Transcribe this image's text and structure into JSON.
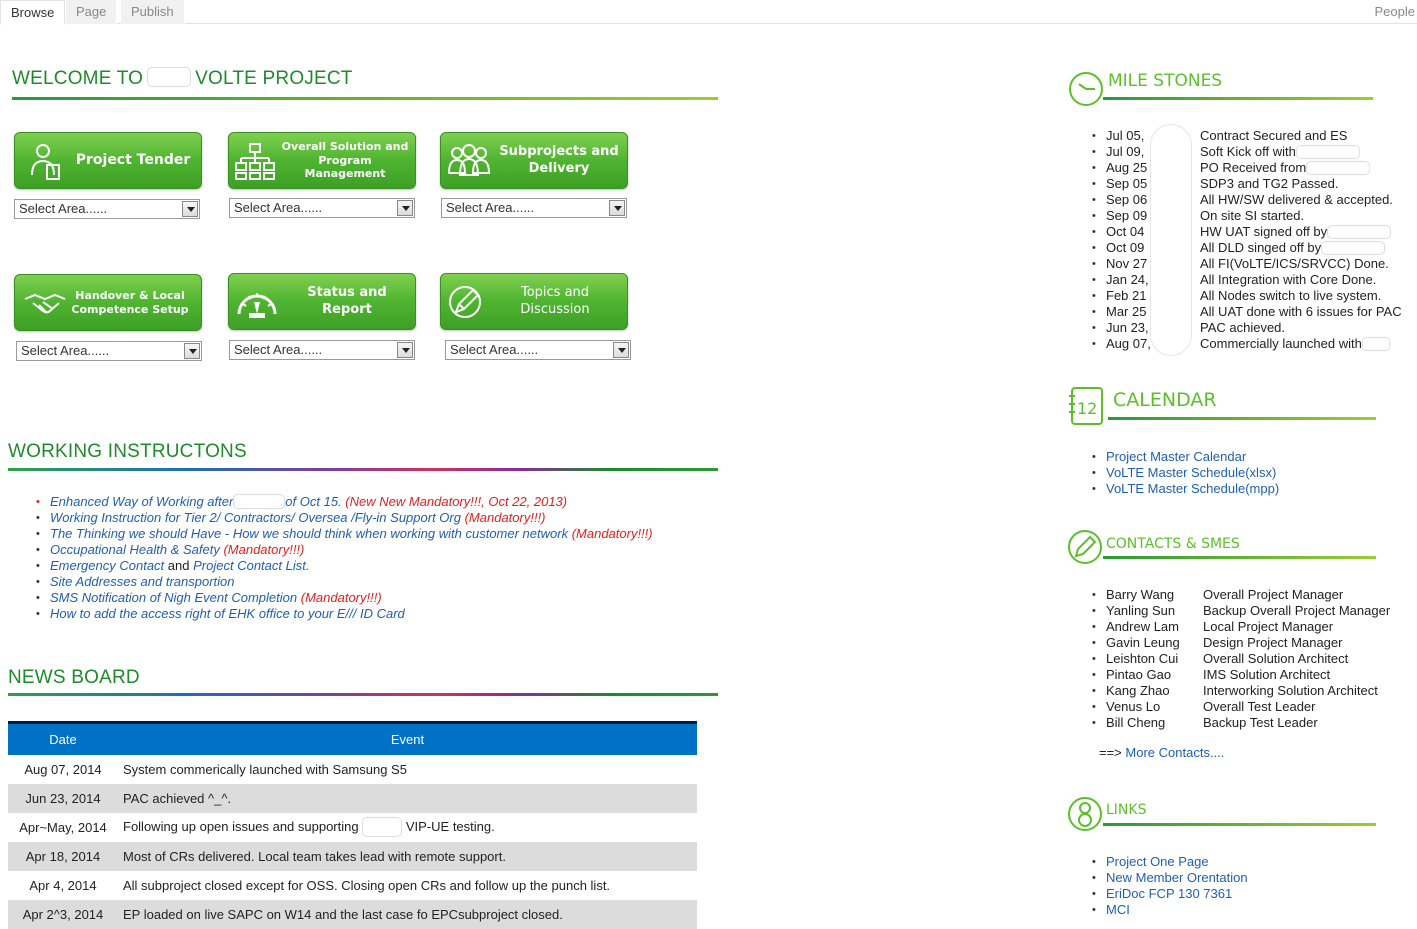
{
  "ribbon": {
    "tabs": [
      "Browse",
      "Page",
      "Publish"
    ],
    "people": "People"
  },
  "welcome": {
    "prefix": "WELCOME TO",
    "suffix": "VOLTE PROJECT"
  },
  "tiles": [
    {
      "label": "Project Tender",
      "icon": "person-doc-icon",
      "select": "Select Area......"
    },
    {
      "label": "Overall Solution and Program Management",
      "icon": "org-chart-icon",
      "select": "Select Area......"
    },
    {
      "label": "Subprojects and Delivery",
      "icon": "team-icon",
      "select": "Select Area......"
    },
    {
      "label": "Handover & Local Competence Setup",
      "icon": "handshake-icon",
      "select": "Select Area......"
    },
    {
      "label": "Status and Report",
      "icon": "gauge-icon",
      "select": "Select Area......"
    },
    {
      "label": "Topics and Discussion",
      "icon": "pencil-icon",
      "select": "Select Area......"
    }
  ],
  "working_instructions": {
    "title": "WORKING INSTRUCTONS",
    "items": {
      "i0": {
        "link_a": "Enhanced Way of Working after",
        "link_b": "of Oct 15.",
        "note": "(New New Mandatory!!!, Oct 22, 2013)"
      },
      "i1": {
        "link": "Working Instruction for Tier 2/ Contractors/ Oversea /Fly-in Support Org",
        "note": "(Mandatory!!!)"
      },
      "i2": {
        "link": "The Thinking we should Have - How we should think when working with customer network",
        "note": "(Mandatory!!!)"
      },
      "i3": {
        "link": "Occupational Health & Safety",
        "note": "(Mandatory!!!)"
      },
      "i4": {
        "link_a": "Emergency Contact",
        "and": "and",
        "link_b": "Project Contact List."
      },
      "i5": {
        "link": "Site Addresses and transportion"
      },
      "i6": {
        "link": "SMS Notification of Nigh Event Completion",
        "note": "(Mandatory!!!)"
      },
      "i7": {
        "link": "How to add the access right of EHK office to your E/// ID Card"
      }
    }
  },
  "news": {
    "title": "NEWS BOARD",
    "col_date": "Date",
    "col_event": "Event",
    "rows": {
      "r0": {
        "date": "Aug 07, 2014",
        "event": "System commerically launched with Samsung S5"
      },
      "r1": {
        "date": "Jun 23, 2014",
        "event": "PAC achieved ^_^."
      },
      "r2": {
        "date": "Apr~May, 2014",
        "event_a": "Following up open issues and supporting",
        "event_b": "VIP-UE testing."
      },
      "r3": {
        "date": "Apr 18, 2014",
        "event": "Most of CRs delivered. Local team takes lead with remote support."
      },
      "r4": {
        "date": "Apr 4, 2014",
        "event": "All subproject closed except for OSS. Closing open CRs and follow up the punch list."
      },
      "r5": {
        "date": "Apr 2^3, 2014",
        "event": "EP loaded on live SAPC on W14 and the last case fo EPCsubproject closed."
      }
    }
  },
  "milestones": {
    "title": "MILE STONES",
    "items": {
      "m0": {
        "date": "Jul 05,",
        "text": "Contract Secured and ES"
      },
      "m1": {
        "date": "Jul 09,",
        "text": "Soft Kick off with"
      },
      "m2": {
        "date": "Aug 25",
        "text": "PO Received from"
      },
      "m3": {
        "date": "Sep 05",
        "text": "SDP3 and TG2 Passed."
      },
      "m4": {
        "date": "Sep 06",
        "text": "All HW/SW delivered & accepted."
      },
      "m5": {
        "date": "Sep 09",
        "text": "On site SI started."
      },
      "m6": {
        "date": "Oct 04",
        "text": "HW UAT signed off by"
      },
      "m7": {
        "date": "Oct 09",
        "text": "All DLD singed off by"
      },
      "m8": {
        "date": "Nov 27",
        "text": "All FI(VoLTE/ICS/SRVCC) Done."
      },
      "m9": {
        "date": "Jan 24,",
        "text": "All Integration with Core Done."
      },
      "m10": {
        "date": "Feb 21",
        "text": "All Nodes switch to live system."
      },
      "m11": {
        "date": "Mar 25",
        "text": "All UAT done with 6 issues for PAC"
      },
      "m12": {
        "date": "Jun 23,",
        "text": "PAC achieved."
      },
      "m13": {
        "date": "Aug 07,",
        "text": "Commercially launched with"
      }
    }
  },
  "calendar": {
    "title": "CALENDAR",
    "icon_number": "12",
    "links": [
      "Project Master Calendar",
      "VoLTE Master Schedule(xlsx)",
      "VoLTE Master Schedule(mpp)"
    ]
  },
  "contacts": {
    "title": "CONTACTS & SMES",
    "people": {
      "c0": {
        "name": "Barry Wang",
        "role": "Overall Project Manager"
      },
      "c1": {
        "name": "Yanling Sun",
        "role": "Backup Overall Project Manager"
      },
      "c2": {
        "name": "Andrew Lam",
        "role": "Local Project Manager"
      },
      "c3": {
        "name": "Gavin Leung",
        "role": "Design Project Manager"
      },
      "c4": {
        "name": "Leishton Cui",
        "role": "Overall Solution Architect"
      },
      "c5": {
        "name": "Pintao Gao",
        "role": "IMS Solution Architect"
      },
      "c6": {
        "name": "Kang Zhao",
        "role": "Interworking Solution Architect"
      },
      "c7": {
        "name": "Venus Lo",
        "role": "Overall Test Leader"
      },
      "c8": {
        "name": "Bill Cheng",
        "role": "Backup Test Leader"
      }
    },
    "more_prefix": "==>",
    "more_link": "More Contacts...."
  },
  "links": {
    "title": "LINKS",
    "items": [
      "Project One Page",
      "New Member Orentation",
      "EriDoc FCP 130 7361",
      "MCI"
    ]
  },
  "colors": {
    "heading_green": "#1f8a2b",
    "tile_green": "#4fb431",
    "link_blue": "#1f5fb0",
    "mandatory_red": "#e02020",
    "table_header_blue": "#0072c6"
  }
}
